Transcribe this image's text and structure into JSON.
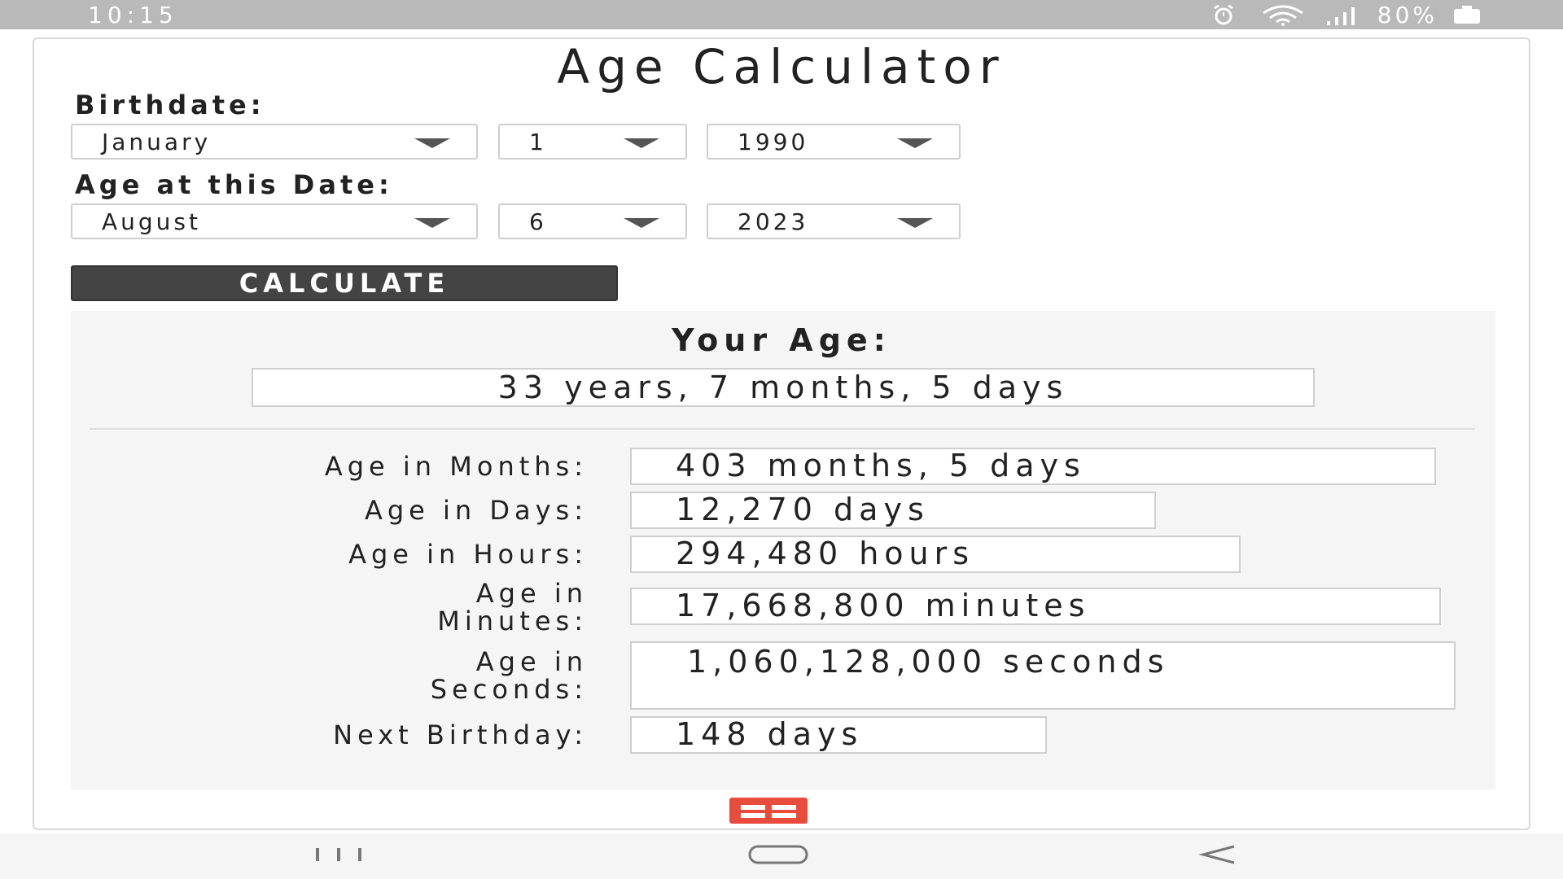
{
  "status_bar": {
    "time": "10:15",
    "battery_percent": "80%",
    "icons": [
      "alarm-icon",
      "wifi-icon",
      "signal-icon",
      "battery-icon"
    ]
  },
  "app": {
    "title": "Age Calculator"
  },
  "birthdate": {
    "label": "Birthdate:",
    "month": "January",
    "day": "1",
    "year": "1990"
  },
  "target_date": {
    "label": "Age at this Date:",
    "month": "August",
    "day": "6",
    "year": "2023"
  },
  "calculate_button": "CALCULATE",
  "results": {
    "heading": "Your Age:",
    "age": "33 years, 7 months, 5 days",
    "rows": [
      {
        "label": "Age in Months:",
        "value": "403 months, 5 days"
      },
      {
        "label": "Age in Days:",
        "value": "12,270 days"
      },
      {
        "label": "Age in Hours:",
        "value": "294,480 hours"
      },
      {
        "label": "Age in Minutes:",
        "value": "17,668,800 minutes"
      },
      {
        "label": "Age in Seconds:",
        "value": "1,060,128,000 seconds"
      },
      {
        "label": "Next Birthday:",
        "value": "148 days"
      }
    ]
  },
  "colors": {
    "status_bar": "#b9b9b9",
    "button": "#444444",
    "panel": "#f5f5f5",
    "ad_icon": "#e84c3d"
  },
  "nav_bar": {
    "icons": [
      "recent-apps-icon",
      "home-icon",
      "back-icon"
    ]
  }
}
